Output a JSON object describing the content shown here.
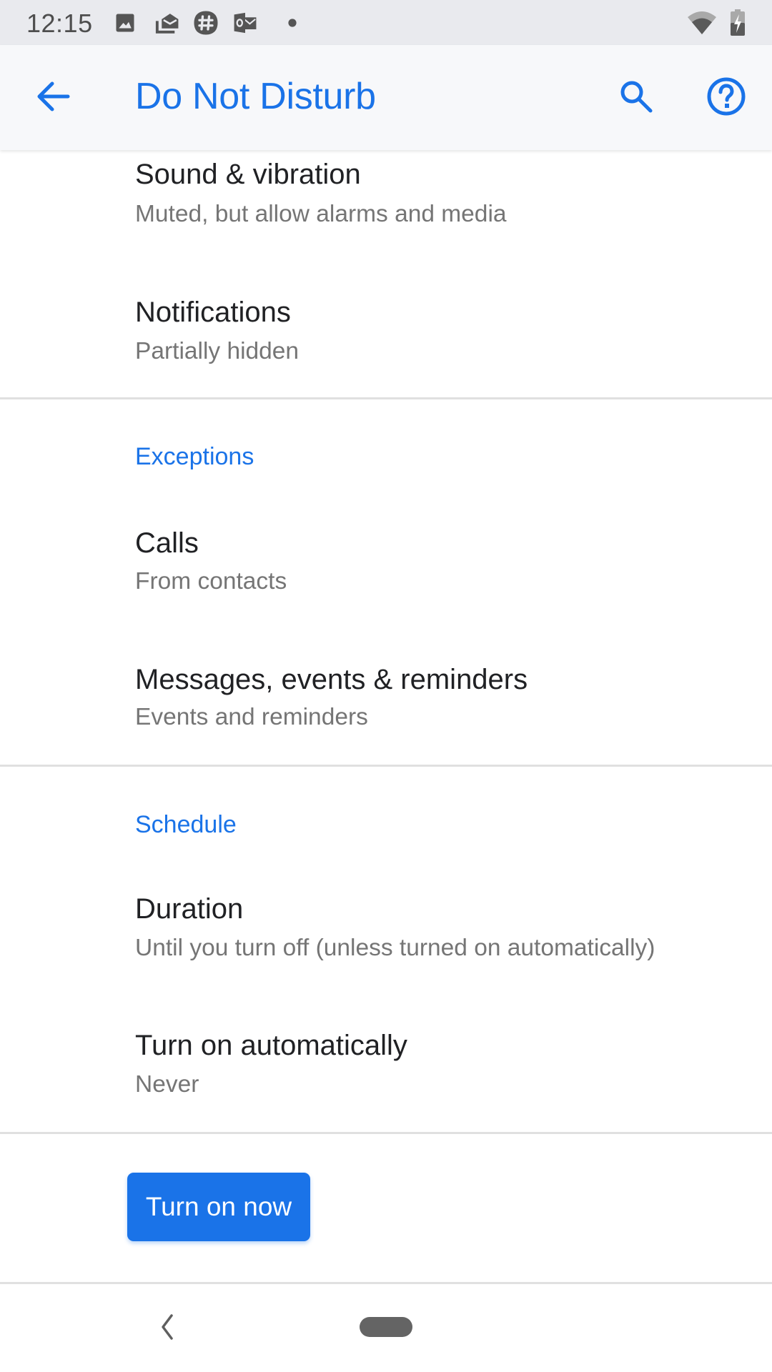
{
  "status_bar": {
    "time": "12:15",
    "notification_icons": [
      "image-icon",
      "mail-stack-icon",
      "slack-icon",
      "outlook-icon",
      "more-dot-icon"
    ],
    "system_icons": [
      "wifi-icon",
      "battery-charging-icon"
    ]
  },
  "app_bar": {
    "title": "Do Not Disturb",
    "back_icon": "arrow-back-icon",
    "actions": [
      "search-icon",
      "help-icon"
    ]
  },
  "sections": [
    {
      "category": null,
      "items": [
        {
          "title": "Sound & vibration",
          "summary": "Muted, but allow alarms and media"
        },
        {
          "title": "Notifications",
          "summary": "Partially hidden"
        }
      ]
    },
    {
      "category": "Exceptions",
      "items": [
        {
          "title": "Calls",
          "summary": "From contacts"
        },
        {
          "title": "Messages, events & reminders",
          "summary": "Events and reminders"
        }
      ]
    },
    {
      "category": "Schedule",
      "items": [
        {
          "title": "Duration",
          "summary": "Until you turn off (unless turned on automatically)"
        },
        {
          "title": "Turn on automatically",
          "summary": "Never"
        }
      ]
    }
  ],
  "primary_button": {
    "label": "Turn on now"
  },
  "nav_bar": {
    "buttons": [
      "back",
      "home"
    ]
  },
  "colors": {
    "accent": "#1a73e8",
    "title_text": "#202124",
    "summary_text": "#757575",
    "status_bar_bg": "#e9eaee",
    "app_bar_bg": "#f7f8fa"
  }
}
